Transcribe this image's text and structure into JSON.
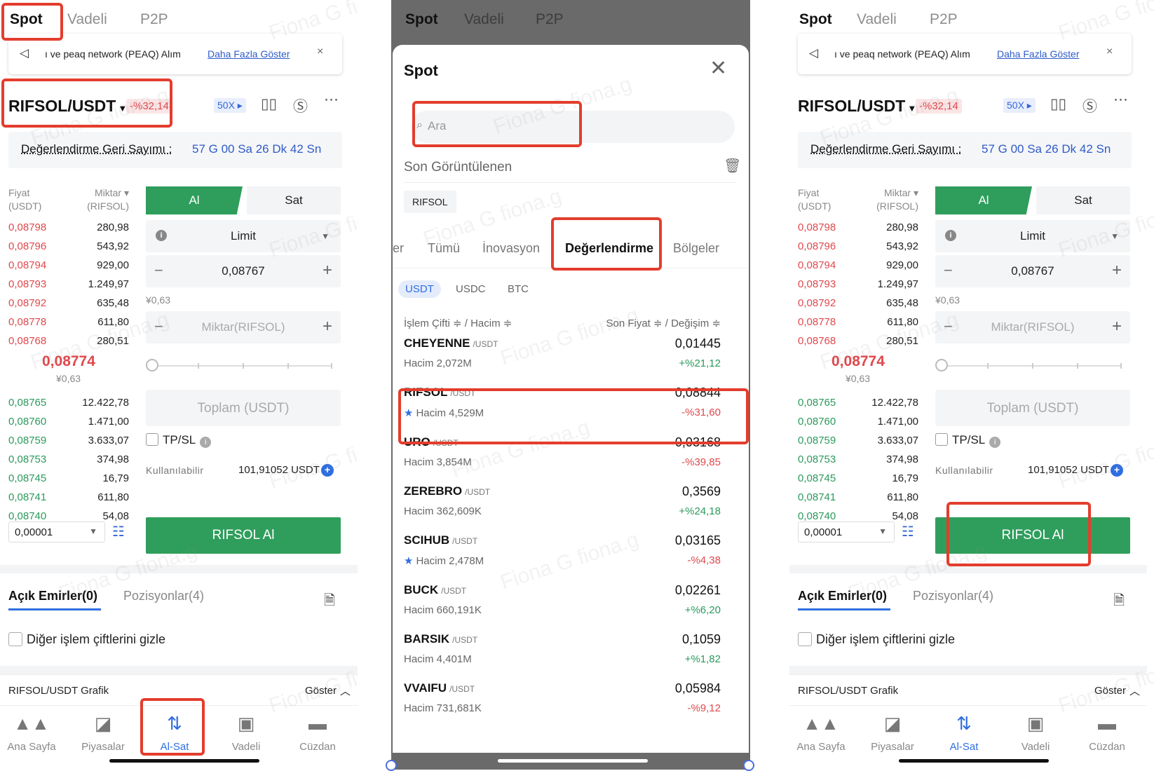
{
  "top_tabs": [
    "Spot",
    "Vadeli",
    "P2P"
  ],
  "announcement": {
    "text": "ı ve peaq network (PEAQ) Alım",
    "link": "Daha Fazla Göster",
    "close": "×"
  },
  "pair": {
    "name": "RIFSOL/USDT",
    "caret": "▼",
    "change": "-%32,14",
    "leverage": "50X ▸"
  },
  "countdown": {
    "label": "Değerlendirme Geri Sayımı :",
    "value": "57 G 00 Sa 26 Dk 42 Sn"
  },
  "orderbook": {
    "price_header": "Fiyat",
    "price_unit": "(USDT)",
    "qty_header": "Miktar ▾",
    "qty_unit": "(RIFSOL)",
    "asks": [
      {
        "p": "0,08798",
        "q": "280,98"
      },
      {
        "p": "0,08796",
        "q": "543,92"
      },
      {
        "p": "0,08794",
        "q": "929,00"
      },
      {
        "p": "0,08793",
        "q": "1.249,97"
      },
      {
        "p": "0,08792",
        "q": "635,48"
      },
      {
        "p": "0,08778",
        "q": "611,80"
      },
      {
        "p": "0,08768",
        "q": "280,51"
      }
    ],
    "mid": "0,08774",
    "mid_sub": "¥0,63",
    "bids": [
      {
        "p": "0,08765",
        "q": "12.422,78"
      },
      {
        "p": "0,08760",
        "q": "1.471,00"
      },
      {
        "p": "0,08759",
        "q": "3.633,07"
      },
      {
        "p": "0,08753",
        "q": "374,98"
      },
      {
        "p": "0,08745",
        "q": "16,79"
      },
      {
        "p": "0,08741",
        "q": "611,80"
      },
      {
        "p": "0,08740",
        "q": "54,08"
      }
    ],
    "step": "0,00001"
  },
  "form": {
    "buy_tab": "Al",
    "sell_tab": "Sat",
    "order_type": "Limit",
    "price": "0,08767",
    "price_sub": "¥0,63",
    "amount_placeholder": "Miktar(RIFSOL)",
    "total_placeholder": "Toplam (USDT)",
    "tpsl": "TP/SL",
    "available_label": "Kullanılabilir",
    "available_value": "101,91052 USDT",
    "submit": "RIFSOL Al"
  },
  "orders": {
    "open": "Açık Emirler(0)",
    "positions": "Pozisyonlar(4)",
    "hide_others": "Diğer işlem çiftlerini gizle"
  },
  "chart_bar": {
    "label": "RIFSOL/USDT Grafik",
    "show": "Göster"
  },
  "bottom_nav": [
    {
      "label": "Ana Sayfa",
      "icon": "▲▲"
    },
    {
      "label": "Piyasalar",
      "icon": "◪"
    },
    {
      "label": "Al-Sat",
      "icon": "⇅"
    },
    {
      "label": "Vadeli",
      "icon": "▣"
    },
    {
      "label": "Cüzdan",
      "icon": "▬"
    }
  ],
  "modal": {
    "title": "Spot",
    "search_placeholder": "Ara",
    "recent_label": "Son Görüntülenen",
    "recent_chip": "RIFSOL",
    "categories": [
      "er",
      "Tümü",
      "İnovasyon",
      "Değerlendirme",
      "Bölgeler"
    ],
    "quotes": [
      "USDT",
      "USDC",
      "BTC"
    ],
    "col_left": "İşlem Çifti ≑ / Hacim ≑",
    "col_right": "Son Fiyat ≑ / Değişim ≑",
    "rows": [
      {
        "name": "CHEYENNE",
        "quote": "/USDT",
        "vol": "Hacim 2,072M",
        "price": "0,01445",
        "chg": "+%21,12",
        "up": true,
        "star": false
      },
      {
        "name": "RIFSOL",
        "quote": "/USDT",
        "vol": "Hacim 4,529M",
        "price": "0,08844",
        "chg": "-%31,60",
        "up": false,
        "star": true
      },
      {
        "name": "URO",
        "quote": "/USDT",
        "vol": "Hacim 3,854M",
        "price": "0,03168",
        "chg": "-%39,85",
        "up": false,
        "star": false
      },
      {
        "name": "ZEREBRO",
        "quote": "/USDT",
        "vol": "Hacim 362,609K",
        "price": "0,3569",
        "chg": "+%24,18",
        "up": true,
        "star": false
      },
      {
        "name": "SCIHUB",
        "quote": "/USDT",
        "vol": "Hacim 2,478M",
        "price": "0,03165",
        "chg": "-%4,38",
        "up": false,
        "star": true
      },
      {
        "name": "BUCK",
        "quote": "/USDT",
        "vol": "Hacim 660,191K",
        "price": "0,02261",
        "chg": "+%6,20",
        "up": true,
        "star": false
      },
      {
        "name": "BARSIK",
        "quote": "/USDT",
        "vol": "Hacim 4,401M",
        "price": "0,1059",
        "chg": "+%1,82",
        "up": true,
        "star": false
      },
      {
        "name": "VVAIFU",
        "quote": "/USDT",
        "vol": "Hacim 731,681K",
        "price": "0,05984",
        "chg": "-%9,12",
        "up": false,
        "star": false
      }
    ]
  },
  "watermark": "Fiona G fiona.g",
  "colors": {
    "accent": "#2f6ee0",
    "buy": "#2f9e5c",
    "sell": "#e0484c",
    "highlight": "#e33d2d"
  }
}
